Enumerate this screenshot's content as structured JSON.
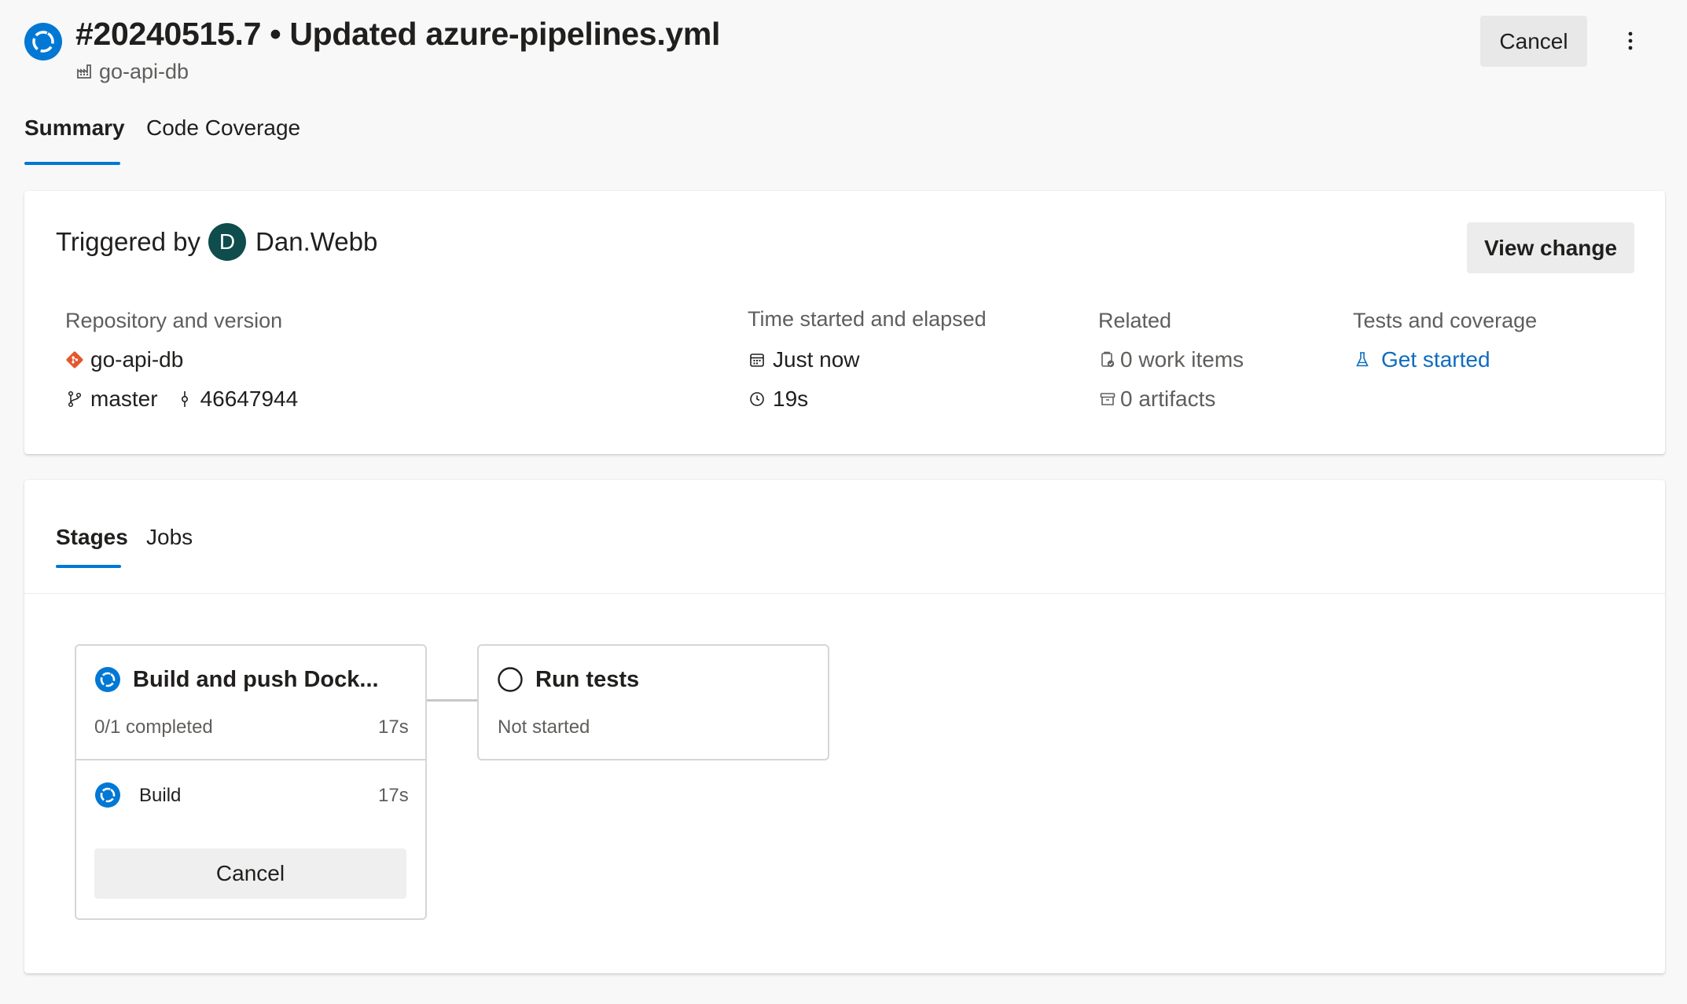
{
  "header": {
    "title": "#20240515.7 • Updated azure-pipelines.yml",
    "pipeline_name": "go-api-db",
    "cancel_label": "Cancel",
    "status_color": "#0078d4"
  },
  "tabs": [
    {
      "label": "Summary",
      "selected": true
    },
    {
      "label": "Code Coverage",
      "selected": false
    }
  ],
  "summary": {
    "triggered_by_label": "Triggered by",
    "avatar_initial": "D",
    "user": "Dan.Webb",
    "view_change_label": "View change",
    "repository": {
      "heading": "Repository and version",
      "repo": "go-api-db",
      "branch": "master",
      "commit": "46647944"
    },
    "time": {
      "heading": "Time started and elapsed",
      "started": "Just now",
      "elapsed": "19s"
    },
    "related": {
      "heading": "Related",
      "work_items": "0 work items",
      "artifacts": "0 artifacts"
    },
    "tests": {
      "heading": "Tests and coverage",
      "link": "Get started"
    }
  },
  "stages_tabs": [
    {
      "label": "Stages",
      "selected": true
    },
    {
      "label": "Jobs",
      "selected": false
    }
  ],
  "stages": [
    {
      "title": "Build and push Dock...",
      "status": "running",
      "progress": "0/1 completed",
      "duration": "17s",
      "jobs": [
        {
          "name": "Build",
          "duration": "17s",
          "status": "running"
        }
      ],
      "cancel_label": "Cancel"
    },
    {
      "title": "Run tests",
      "status": "Not started"
    }
  ]
}
